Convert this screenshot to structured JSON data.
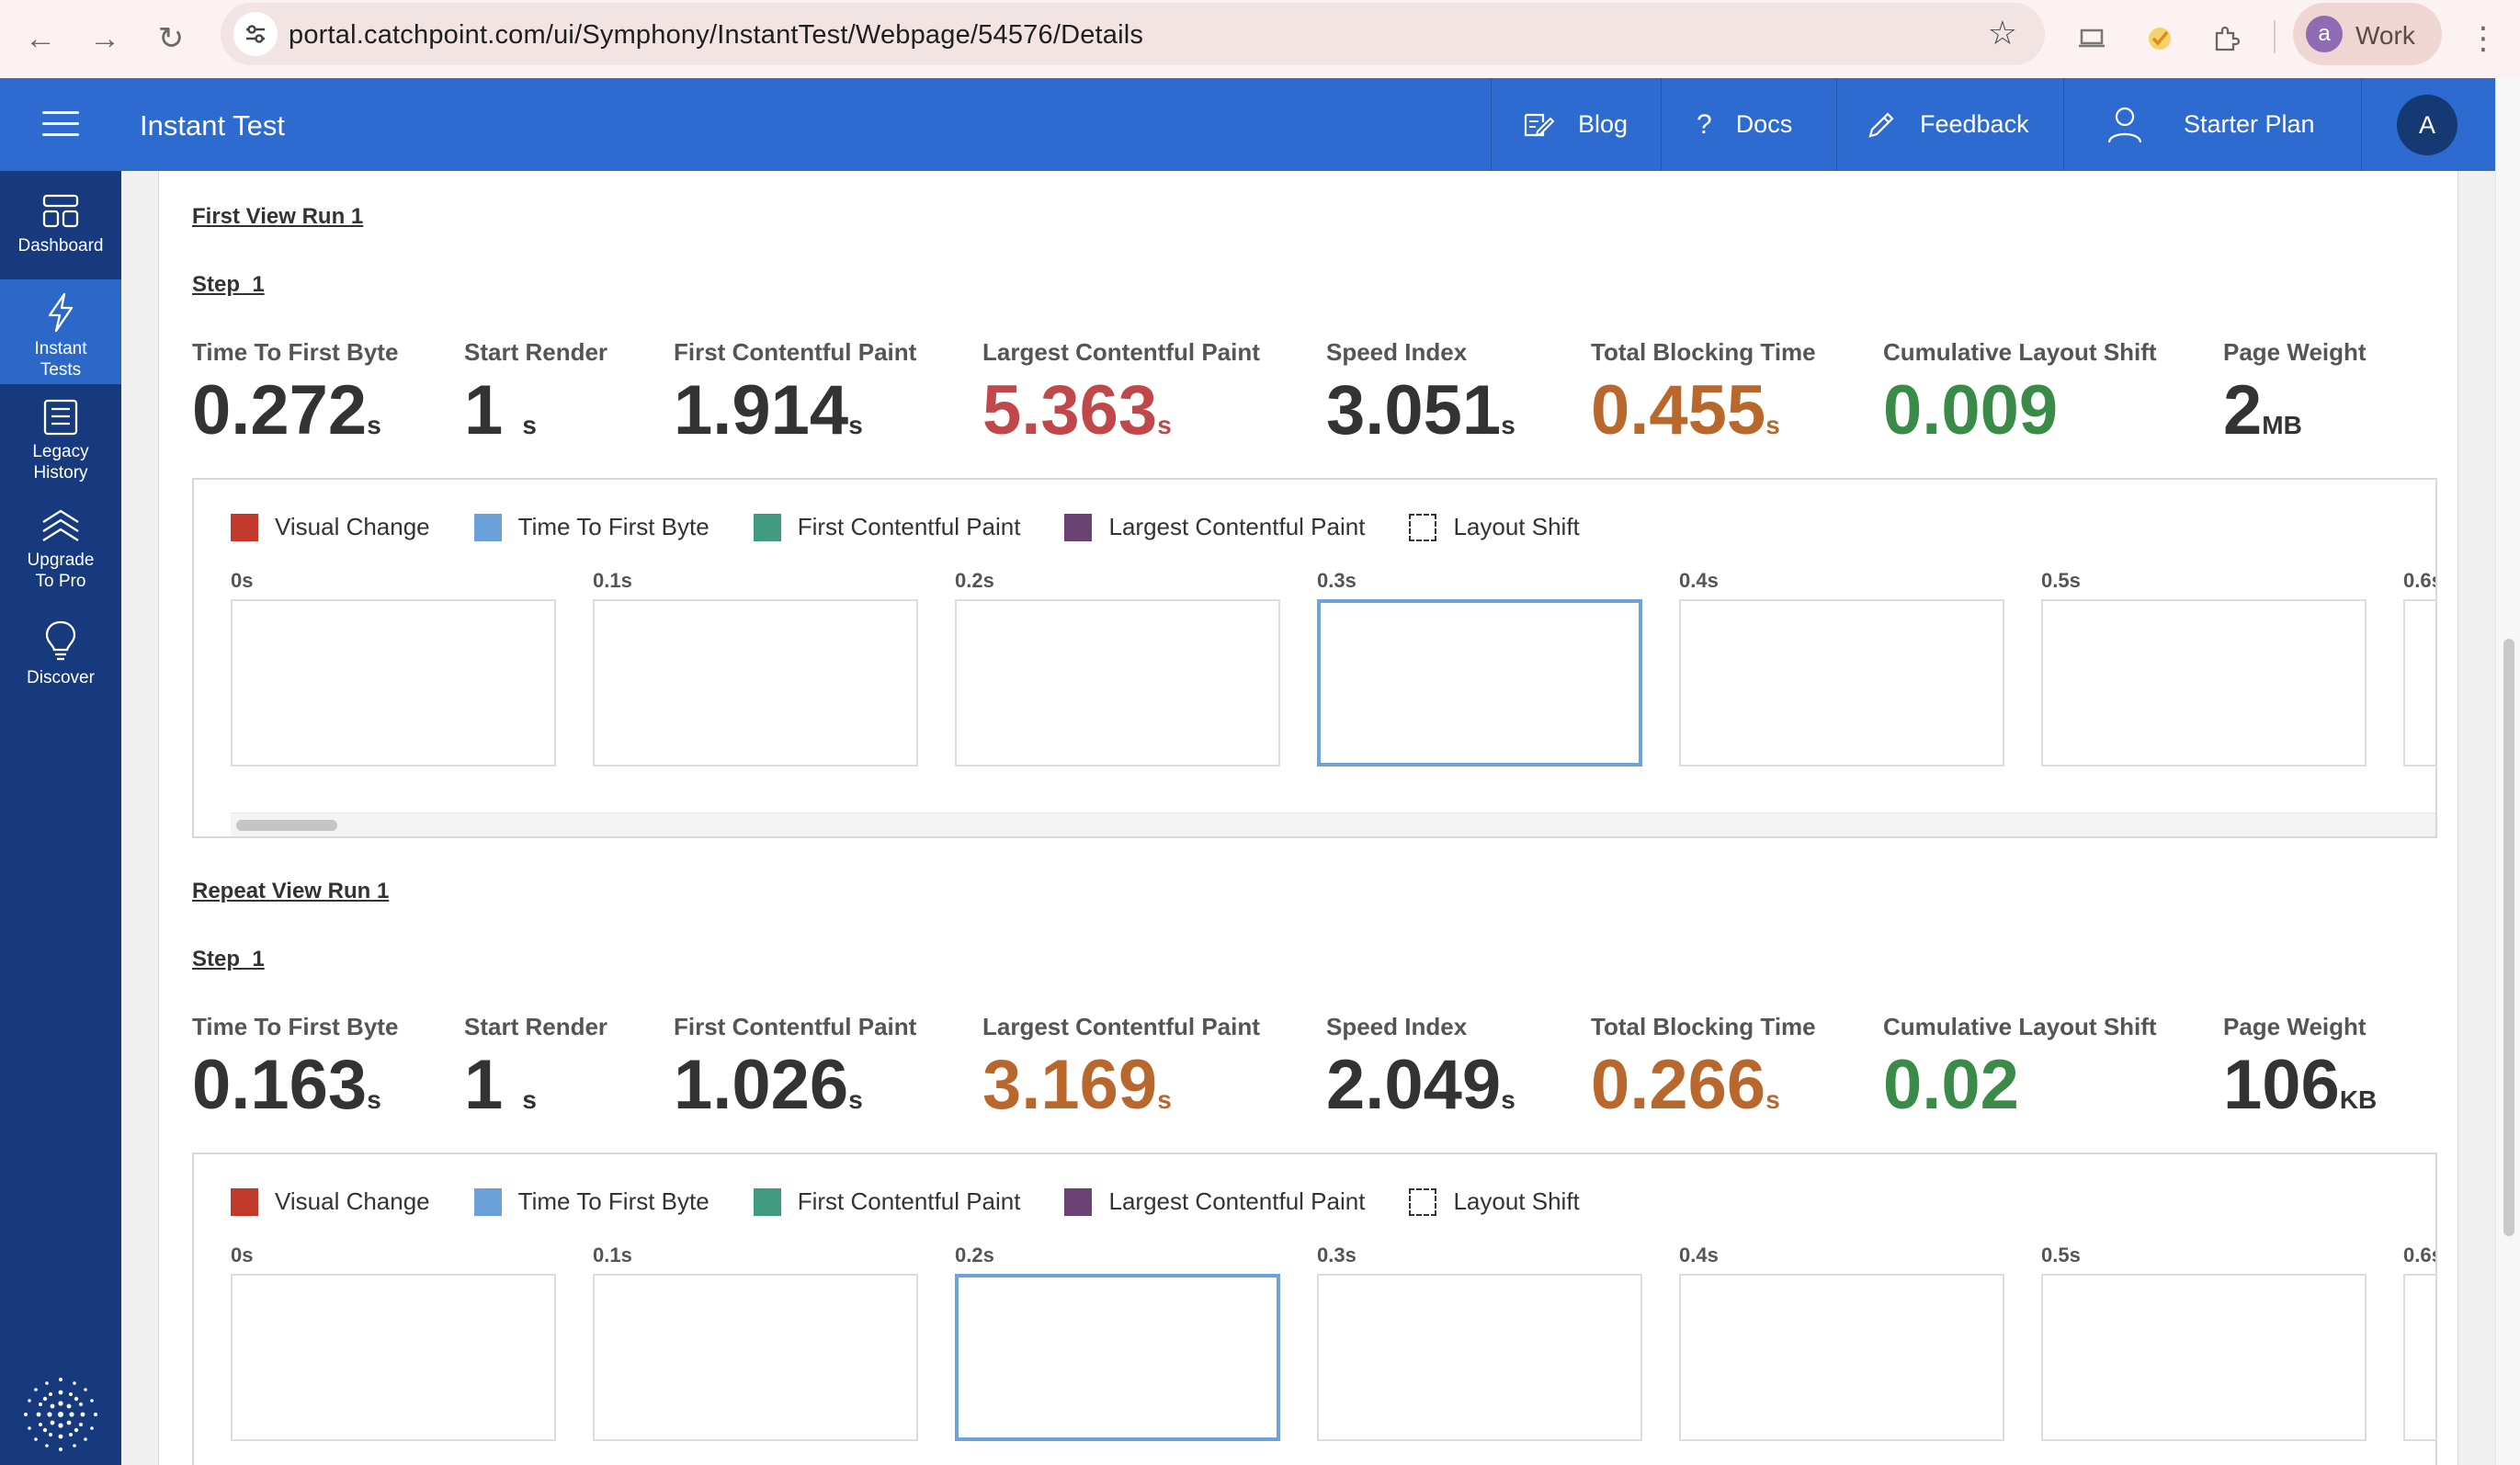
{
  "browser": {
    "url": "portal.catchpoint.com/ui/Symphony/InstantTest/Webpage/54576/Details",
    "profile_initial": "a",
    "profile_name": "Work"
  },
  "header": {
    "title": "Instant Test",
    "blog": "Blog",
    "docs": "Docs",
    "feedback": "Feedback",
    "plan": "Starter Plan",
    "avatar": "A"
  },
  "sidebar": {
    "items": [
      {
        "label": "Dashboard",
        "icon": "dashboard-icon"
      },
      {
        "label": "Instant Tests",
        "icon": "lightning-icon"
      },
      {
        "label": "Legacy History",
        "icon": "list-icon"
      },
      {
        "label": "Upgrade To Pro",
        "icon": "chevrons-up-icon"
      },
      {
        "label": "Discover",
        "icon": "lightbulb-icon"
      }
    ]
  },
  "legend": {
    "visual_change": "Visual Change",
    "ttfb": "Time To First Byte",
    "fcp": "First Contentful Paint",
    "lcp": "Largest Contentful Paint",
    "layout_shift": "Layout Shift",
    "colors": {
      "visual_change": "#c0392b",
      "ttfb": "#6ba0d8",
      "fcp": "#3f9a7f",
      "lcp": "#6b4274"
    }
  },
  "ticks": [
    "0s",
    "0.1s",
    "0.2s",
    "0.3s",
    "0.4s",
    "0.5s",
    "0.6s"
  ],
  "first_view": {
    "title": "First View Run 1",
    "step": "Step_1",
    "selected_frame": 3,
    "metrics": [
      {
        "label": "Time To First Byte",
        "value": "0.272",
        "unit": "s",
        "color": "#333333"
      },
      {
        "label": "Start Render",
        "value": "1",
        "unit": "s",
        "color": "#333333"
      },
      {
        "label": "First Contentful Paint",
        "value": "1.914",
        "unit": "s",
        "color": "#333333"
      },
      {
        "label": "Largest Contentful Paint",
        "value": "5.363",
        "unit": "s",
        "color": "#c0484a"
      },
      {
        "label": "Speed Index",
        "value": "3.051",
        "unit": "s",
        "color": "#333333"
      },
      {
        "label": "Total Blocking Time",
        "value": "0.455",
        "unit": "s",
        "color": "#b8682d"
      },
      {
        "label": "Cumulative Layout Shift",
        "value": "0.009",
        "unit": "",
        "color": "#3a8a48"
      },
      {
        "label": "Page Weight",
        "value": "2",
        "unit": "MB",
        "color": "#333333"
      }
    ]
  },
  "repeat_view": {
    "title": "Repeat View Run 1",
    "step": "Step_1",
    "selected_frame": 2,
    "metrics": [
      {
        "label": "Time To First Byte",
        "value": "0.163",
        "unit": "s",
        "color": "#333333"
      },
      {
        "label": "Start Render",
        "value": "1",
        "unit": "s",
        "color": "#333333"
      },
      {
        "label": "First Contentful Paint",
        "value": "1.026",
        "unit": "s",
        "color": "#333333"
      },
      {
        "label": "Largest Contentful Paint",
        "value": "3.169",
        "unit": "s",
        "color": "#b8682d"
      },
      {
        "label": "Speed Index",
        "value": "2.049",
        "unit": "s",
        "color": "#333333"
      },
      {
        "label": "Total Blocking Time",
        "value": "0.266",
        "unit": "s",
        "color": "#b8682d"
      },
      {
        "label": "Cumulative Layout Shift",
        "value": "0.02",
        "unit": "",
        "color": "#3a8a48"
      },
      {
        "label": "Page Weight",
        "value": "106",
        "unit": "KB",
        "color": "#333333"
      }
    ]
  }
}
